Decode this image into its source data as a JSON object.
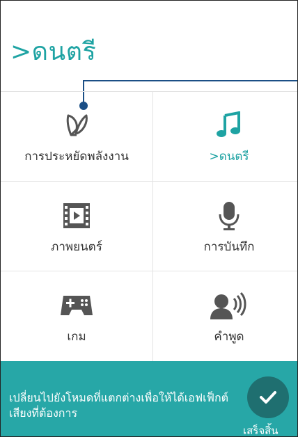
{
  "header": {
    "title": ">ดนตรี"
  },
  "modes": [
    {
      "label": "การประหยัดพลังงาน",
      "icon": "leaf-icon",
      "active": false
    },
    {
      "label": ">ดนตรี",
      "icon": "music-note-icon",
      "active": true
    },
    {
      "label": "ภาพยนตร์",
      "icon": "movie-icon",
      "active": false
    },
    {
      "label": "การบันทึก",
      "icon": "microphone-icon",
      "active": false
    },
    {
      "label": "เกม",
      "icon": "gamepad-icon",
      "active": false
    },
    {
      "label": "คำพูด",
      "icon": "speech-icon",
      "active": false
    }
  ],
  "bottom": {
    "message": "เปลี่ยนไปยังโหมดที่แตกต่างเพื่อให้ได้เอฟเฟ็กต์เสียงที่ต้องการ",
    "done_label": "เสร็จสิ้น",
    "done_icon": "check-icon"
  },
  "colors": {
    "accent": "#1ea3a3",
    "callout": "#1b4f86",
    "bottom_bar": "#27a7a7",
    "done_button": "#1f6f70",
    "icon_gray": "#555555"
  }
}
